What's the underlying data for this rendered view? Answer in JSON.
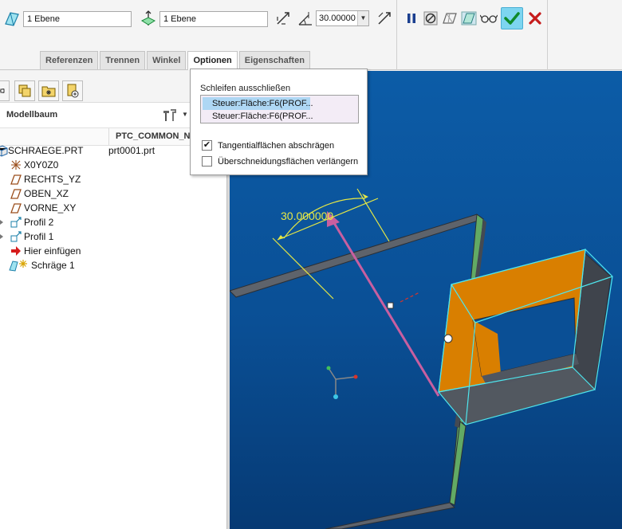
{
  "dashboard": {
    "field1_value": "1 Ebene",
    "field2_value": "1 Ebene",
    "angle_value": "30.00000",
    "tabs": [
      "Referenzen",
      "Trennen",
      "Winkel",
      "Optionen",
      "Eigenschaften"
    ],
    "active_tab": "Optionen"
  },
  "options_panel": {
    "exclude_loops_label": "Schleifen ausschließen",
    "loops": [
      "Steuer:Fläche:F6(PROF...",
      "Steuer:Fläche:F6(PROF..."
    ],
    "checkbox_tangent_label": "Tangentialflächen abschrägen",
    "checkbox_tangent_checked": true,
    "checkbox_extend_label": "Überschneidungsflächen verlängern",
    "checkbox_extend_checked": false
  },
  "model_tree": {
    "title": "Modellbaum",
    "column_header": "PTC_COMMON_N",
    "rows": [
      {
        "label": "SCHRAEGE.PRT",
        "value": "prt0001.prt",
        "icon": "part-icon"
      },
      {
        "label": "X0Y0Z0",
        "value": "",
        "icon": "coordinate-system-icon"
      },
      {
        "label": "RECHTS_YZ",
        "value": "",
        "icon": "datum-plane-icon"
      },
      {
        "label": "OBEN_XZ",
        "value": "",
        "icon": "datum-plane-icon"
      },
      {
        "label": "VORNE_XY",
        "value": "",
        "icon": "datum-plane-icon"
      },
      {
        "label": "Profil 2",
        "value": "",
        "icon": "extrude-icon"
      },
      {
        "label": "Profil 1",
        "value": "",
        "icon": "extrude-icon"
      },
      {
        "label": "Hier einfügen",
        "value": "",
        "icon": "insert-here-arrow-icon"
      },
      {
        "label": "Schräge 1",
        "value": "",
        "icon": "draft-icon"
      }
    ]
  },
  "viewport": {
    "angle_dimension": "30.000000"
  }
}
